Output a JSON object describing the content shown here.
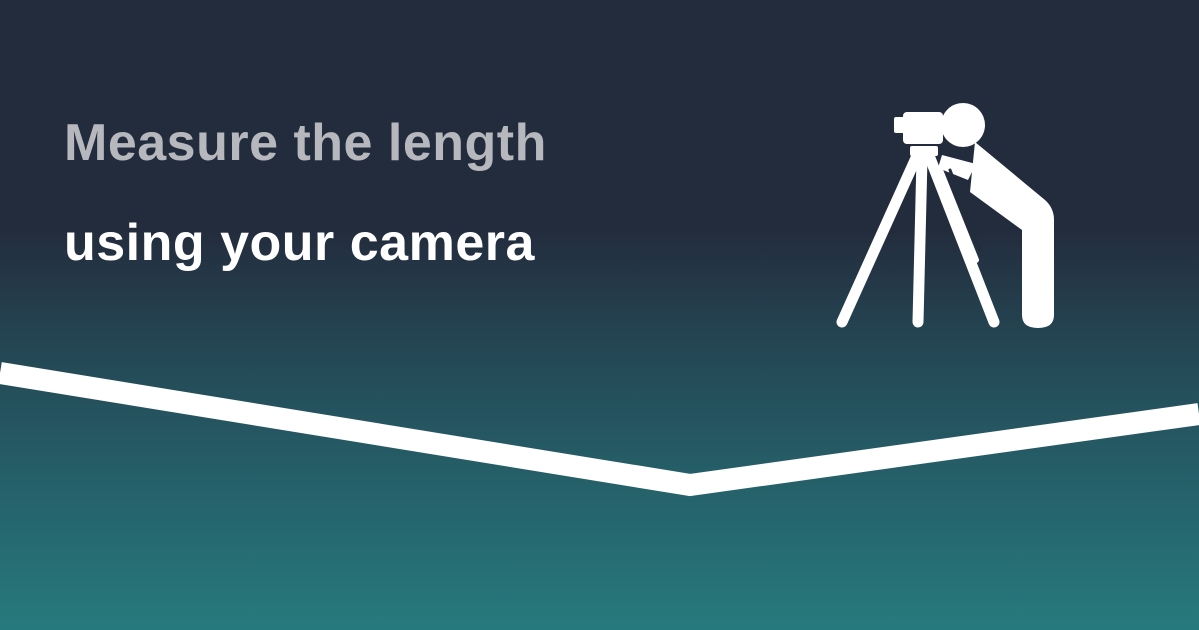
{
  "headline": {
    "line1": "Measure the length",
    "line2": "using your camera"
  },
  "icons": {
    "surveyor": "surveyor-with-tripod-camera-icon"
  },
  "colors": {
    "background_top": "#232c3d",
    "background_bottom": "#267a7d",
    "headline_line1": "#b7b8bd",
    "headline_line2": "#ffffff",
    "accent_line": "#ffffff"
  }
}
